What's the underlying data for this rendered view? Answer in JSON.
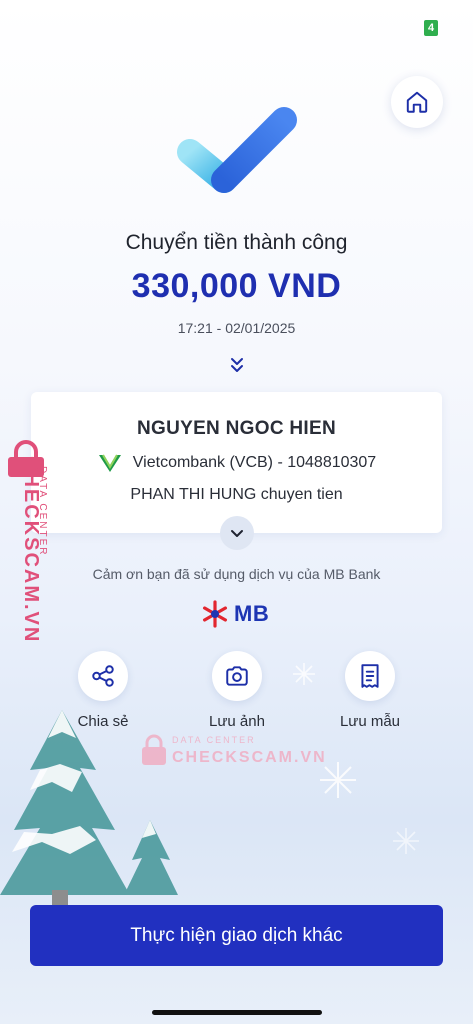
{
  "status_bar": {
    "badge": "4"
  },
  "header": {
    "home_icon": "home-icon"
  },
  "result": {
    "title": "Chuyển tiền thành công",
    "amount": "330,000 VND",
    "datetime": "17:21 - 02/01/2025"
  },
  "recipient": {
    "name": "NGUYEN NGOC HIEN",
    "bank": "Vietcombank (VCB) - 1048810307",
    "description": "PHAN THI HUNG chuyen tien"
  },
  "footer": {
    "thanks": "Cảm ơn bạn đã sử dụng dịch vụ của MB Bank",
    "brand": "MB"
  },
  "actions": [
    {
      "label": "Chia sẻ",
      "icon": "share-icon"
    },
    {
      "label": "Lưu ảnh",
      "icon": "camera-icon"
    },
    {
      "label": "Lưu mẫu",
      "icon": "template-icon"
    }
  ],
  "watermark": {
    "top_text": "DATA CENTER",
    "brand_text": "CHECKSCAM.VN",
    "color": "#e0507a"
  },
  "primary_button": {
    "label": "Thực hiện giao dịch khác"
  },
  "colors": {
    "accent": "#2130c0",
    "amount": "#1f2fb0",
    "badge": "#2fae4e"
  }
}
